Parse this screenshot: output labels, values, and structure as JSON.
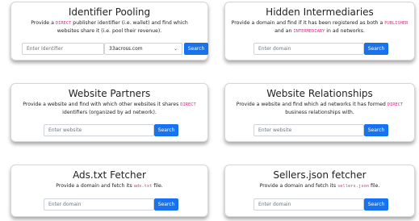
{
  "cards": [
    {
      "title": "Identifier Pooling",
      "desc_before": "Provide a ",
      "desc_code": "DIRECT",
      "desc_after": " publisher identifier (i.e. wallet) and find which websites share it (i.e. pool their revenue).",
      "input_placeholder": "Enter Identifier",
      "select_value": "33across.com",
      "button_label": "Search"
    },
    {
      "title": "Hidden Intermediaries",
      "desc_before": "Provide a domain and find if it has been registered as both a ",
      "desc_code": "PUBLISHER",
      "desc_mid": " and an ",
      "desc_code2": "INTERMEDIARY",
      "desc_after": " in ad networks.",
      "input_placeholder": "Enter domain",
      "button_label": "Search"
    },
    {
      "title": "Website Partners",
      "desc_before": "Provide a website and find with which other websites it shares ",
      "desc_code": "DIRECT",
      "desc_after": " identifiers (organized by ad network).",
      "input_placeholder": "Enter website",
      "button_label": "Search"
    },
    {
      "title": "Website Relationships",
      "desc_before": "Provide a website and find which ad networks it has formed ",
      "desc_code": "DIRECT",
      "desc_after": " business relationships with.",
      "input_placeholder": "Enter website",
      "button_label": "Search"
    },
    {
      "title": "Ads.txt Fetcher",
      "desc_before": "Provide a domain and fetch its ",
      "desc_code": "ads.txt",
      "desc_after": " file.",
      "input_placeholder": "Enter domain",
      "button_label": "Search"
    },
    {
      "title": "Sellers.json fetcher",
      "desc_before": "Provide a domain and fetch its ",
      "desc_code": "sellers.json",
      "desc_after": " file.",
      "input_placeholder": "Enter domain",
      "button_label": "Search"
    }
  ]
}
